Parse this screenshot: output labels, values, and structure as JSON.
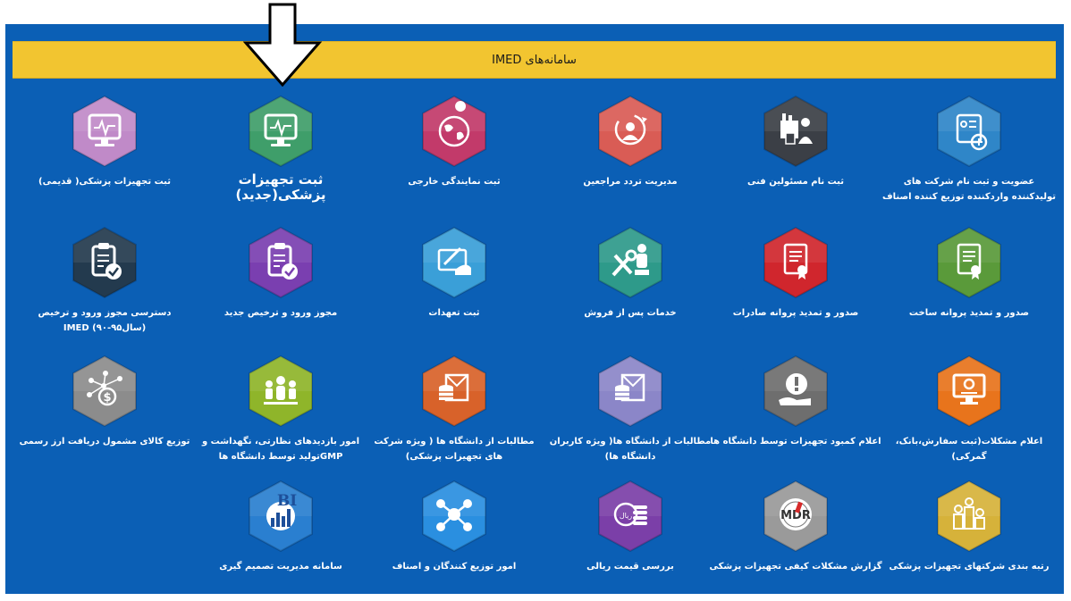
{
  "header": {
    "title": "سامانه‌های IMED"
  },
  "tiles": [
    {
      "label": "عضویت و ثبت نام شرکت های تولیدکننده واردکننده توزیع کننده اصناف",
      "icon": "registration-card-icon",
      "color": "#2f86c8",
      "row": 0,
      "col": 0
    },
    {
      "label": "ثبت نام مسئولین فنی",
      "icon": "technical-staff-icon",
      "color": "#3b3f46",
      "row": 0,
      "col": 1
    },
    {
      "label": "مدیریت تردد مراجعین",
      "icon": "visitor-tracking-icon",
      "color": "#d95c55",
      "row": 0,
      "col": 2
    },
    {
      "label": "ثبت نمایندگی خارجی",
      "icon": "globe-pin-icon",
      "color": "#c23a6a",
      "row": 0,
      "col": 3
    },
    {
      "label": "ثبت تجهیزات پزشکی(جدید)",
      "icon": "monitor-ecg-icon",
      "color": "#3f9e6a",
      "row": 0,
      "col": 4,
      "big": true
    },
    {
      "label": "ثبت تجهیزات پزشکی( قدیمی)",
      "icon": "monitor-ecg-icon",
      "color": "#c08ac8",
      "row": 0,
      "col": 5
    },
    {
      "label": "صدور و تمدید پروانه ساخت",
      "icon": "certificate-icon",
      "color": "#5a9a3a",
      "row": 1,
      "col": 0
    },
    {
      "label": "صدور و تمدید پروانه صادرات",
      "icon": "certificate-icon",
      "color": "#d0262d",
      "row": 1,
      "col": 1
    },
    {
      "label": "خدمات پس از فروش",
      "icon": "after-sales-tools-icon",
      "color": "#2e9a8a",
      "row": 1,
      "col": 2
    },
    {
      "label": "ثبت تعهدات",
      "icon": "signing-hand-icon",
      "color": "#3a9fd8",
      "row": 1,
      "col": 3
    },
    {
      "label": "مجوز ورود و ترخیص جدید",
      "icon": "clipboard-check-icon",
      "color": "#7a3fb0",
      "row": 1,
      "col": 4
    },
    {
      "label": "دسترسی مجوز ورود و ترخیص (سال۹۵-۹۰) IMED",
      "icon": "clipboard-check-icon",
      "color": "#233a4e",
      "row": 1,
      "col": 5
    },
    {
      "label": "اعلام مشکلات(ثبت سفارش،بانک، گمرکی)",
      "icon": "monitor-support-icon",
      "color": "#e8741c",
      "row": 2,
      "col": 0
    },
    {
      "label": "اعلام کمبود تجهیزات توسط دانشگاه ها",
      "icon": "alert-hand-icon",
      "color": "#6e6e6e",
      "row": 2,
      "col": 1
    },
    {
      "label": "مطالبات از دانشگاه ها( ویژه کاربران دانشگاه ها)",
      "icon": "coins-envelope-icon",
      "color": "#8b86c8",
      "row": 2,
      "col": 2
    },
    {
      "label": "مطالبات از دانشگاه ها ( ویژه شرکت های تجهیزات پزشکی)",
      "icon": "coins-envelope-icon",
      "color": "#d8622a",
      "row": 2,
      "col": 3
    },
    {
      "label": "امور بازدیدهای نظارتی، نگهداشت و GMPتولید توسط دانشگاه ها",
      "icon": "team-people-icon",
      "color": "#8fb52a",
      "row": 2,
      "col": 4
    },
    {
      "label": "توزیع کالای مشمول دریافت ارز رسمی",
      "icon": "currency-network-icon",
      "color": "#8c8c8c",
      "row": 2,
      "col": 5
    },
    {
      "label": "رتبه بندی شرکتهای تجهیزات پزشکی",
      "icon": "ranking-people-icon",
      "color": "#d6b23a",
      "row": 3,
      "col": 0
    },
    {
      "label": "گزارش مشکلات کیفی تجهیزات پزشکی",
      "icon": "mdr-seal-icon",
      "color": "#9a9a9a",
      "row": 3,
      "col": 1
    },
    {
      "label": "بررسی قیمت ریالی",
      "icon": "rial-coins-icon",
      "color": "#7b3fa8",
      "row": 3,
      "col": 2
    },
    {
      "label": "امور توزیع کنندگان و اصناف",
      "icon": "distribution-network-icon",
      "color": "#2a8fe0",
      "row": 3,
      "col": 3
    },
    {
      "label": "سامانه مدیریت تصمیم گیری",
      "icon": "bi-chart-icon",
      "color": "#2a7fd0",
      "row": 3,
      "col": 4
    }
  ],
  "annotation": {
    "icon": "down-arrow-icon"
  }
}
